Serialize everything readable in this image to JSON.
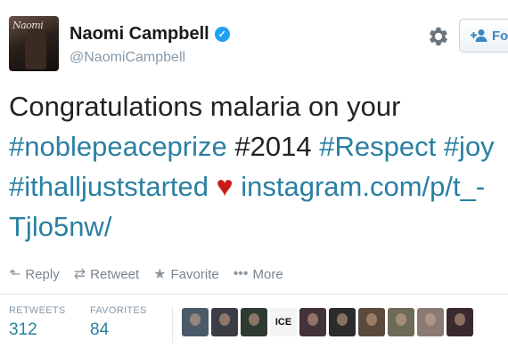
{
  "user": {
    "display_name": "Naomi Campbell",
    "handle": "@NaomiCampbell",
    "avatar_text": "Naomi"
  },
  "follow": {
    "label": "Fo"
  },
  "tweet": {
    "line1": "Congratulations malaria on your",
    "line2": {
      "tag1": "#noblepeaceprize",
      "plain": "#2014",
      "tag2": "#Respect",
      "tag3": "#joy"
    },
    "line3": {
      "tag": "#ithalljuststarted",
      "heart": "♥",
      "link_part1": "instagram.com/p/t_-"
    },
    "line4": {
      "link_part2": "Tjlo5nw/"
    }
  },
  "actions": [
    {
      "icon": "reply-icon",
      "glyph": "⬑",
      "label": "Reply"
    },
    {
      "icon": "retweet-icon",
      "glyph": "⇄",
      "label": "Retweet"
    },
    {
      "icon": "star-icon",
      "glyph": "★",
      "label": "Favorite"
    },
    {
      "icon": "more-icon",
      "glyph": "•••",
      "label": "More"
    }
  ],
  "stats": {
    "retweets_label": "RETWEETS",
    "retweets_value": "312",
    "favorites_label": "FAVORITES",
    "favorites_value": "84"
  },
  "favoriters": [
    {
      "color": "#4b5a6a"
    },
    {
      "color": "#3c3c44"
    },
    {
      "color": "#2f3a33"
    },
    {
      "text": "ICE",
      "color": "#f5f5f5"
    },
    {
      "color": "#44323a"
    },
    {
      "color": "#2c2c2c"
    },
    {
      "color": "#5a4a3c"
    },
    {
      "color": "#6d6a58"
    },
    {
      "color": "#8b7a74"
    },
    {
      "color": "#3a2a30"
    }
  ],
  "colors": {
    "link": "#2a7fa2",
    "heart": "#cc1a1a",
    "verified": "#1da1f2"
  }
}
